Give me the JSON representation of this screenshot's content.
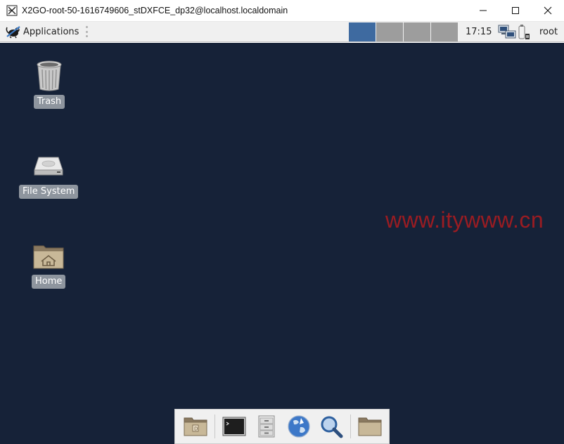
{
  "window": {
    "title": "X2GO-root-50-1616749606_stDXFCE_dp32@localhost.localdomain"
  },
  "panel": {
    "applications_label": "Applications",
    "clock": "17:15",
    "user": "root",
    "workspaces": [
      {
        "active": true
      },
      {
        "active": false
      },
      {
        "active": false
      },
      {
        "active": false
      }
    ]
  },
  "desktop": {
    "icons": [
      {
        "label": "Trash",
        "icon": "trash-icon"
      },
      {
        "label": "File System",
        "icon": "drive-icon"
      },
      {
        "label": "Home",
        "icon": "home-folder-icon"
      }
    ],
    "watermark": "www.itywww.cn"
  },
  "dock": {
    "items": [
      {
        "icon": "desktop-folder-icon"
      },
      {
        "icon": "terminal-icon"
      },
      {
        "icon": "file-manager-icon"
      },
      {
        "icon": "web-browser-icon"
      },
      {
        "icon": "search-icon"
      },
      {
        "icon": "folder-icon"
      }
    ]
  },
  "colors": {
    "desktop_bg": "#162238",
    "panel_bg": "#f0f0f0",
    "workspace_active": "#3e6aa0",
    "workspace_inactive": "#9d9d9d",
    "watermark": "#9a1c22"
  }
}
